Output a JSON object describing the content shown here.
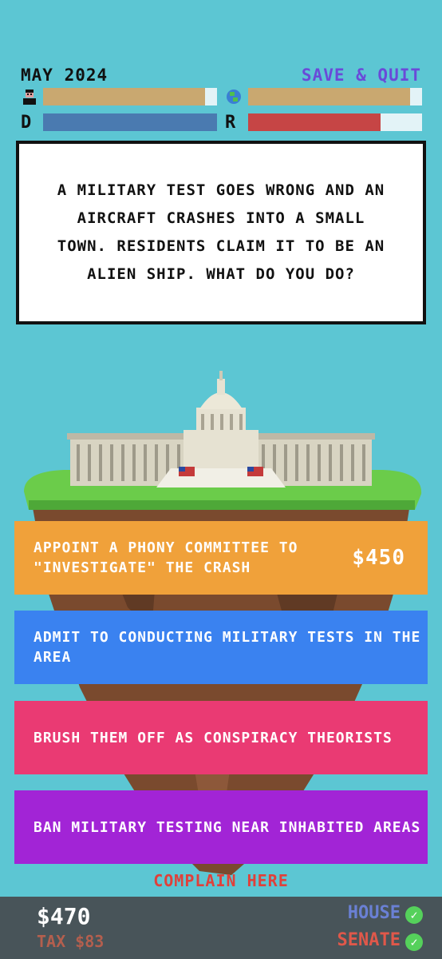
{
  "header": {
    "date": "MAY 2024",
    "save_quit": "SAVE & QUIT"
  },
  "meters": {
    "people": 0.93,
    "world": 0.93,
    "democrats": 1.0,
    "republicans": 0.76
  },
  "meter_labels": {
    "democrats": "D",
    "republicans": "R"
  },
  "colors": {
    "background": "#5cc6d3",
    "meter_tan": "#c9a870",
    "democrats": "#4a7ab0",
    "republicans": "#c64545",
    "choice_1": "#f0a13a",
    "choice_2": "#3a82f0",
    "choice_3": "#ea3a73",
    "choice_4": "#a224d6"
  },
  "prompt": "A military test goes wrong and an aircraft crashes into a small town. Residents claim it to be an alien ship. What do you do?",
  "choices": [
    {
      "text": "Appoint a phony committee to \"investigate\" the crash",
      "cost": "$450"
    },
    {
      "text": "Admit to conducting military tests in the area",
      "cost": ""
    },
    {
      "text": "Brush them off as conspiracy theorists",
      "cost": ""
    },
    {
      "text": "Ban military testing near inhabited areas",
      "cost": ""
    }
  ],
  "complain": "COMPLAIN HERE",
  "footer": {
    "money": "$470",
    "tax": "TAX $83",
    "house": "HOUSE",
    "senate": "SENATE"
  },
  "icons": [
    "person-icon",
    "globe-icon",
    "check-icon"
  ]
}
